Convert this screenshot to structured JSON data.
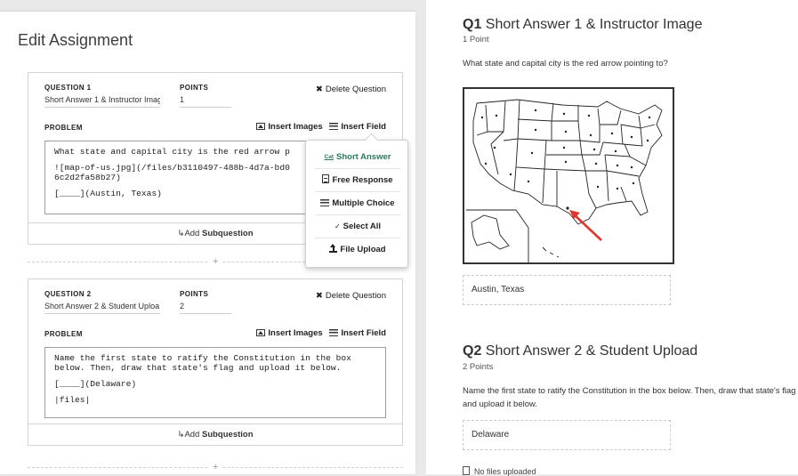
{
  "editor": {
    "title": "Edit Assignment",
    "labels": {
      "question_prefix": "QUESTION",
      "points": "POINTS",
      "problem": "PROBLEM",
      "delete": "Delete Question",
      "insert_images": "Insert Images",
      "insert_field": "Insert Field",
      "add_prefix": "Add",
      "subquestion": "Subquestion",
      "plus": "+"
    },
    "questions": [
      {
        "label": "QUESTION 1",
        "name": "Short Answer 1 & Instructor Imag",
        "points": "1",
        "problem_lines": [
          "What state and capital city is the red arrow p",
          "![map-of-us.jpg](/files/b3110497-488b-4d7a-bd0\n6c2d2fa58b27)",
          "[____](Austin, Texas)"
        ]
      },
      {
        "label": "QUESTION 2",
        "name": "Short Answer 2 & Student Uploa",
        "points": "2",
        "problem_lines": [
          "Name the first state to ratify the Constitution in the box\nbelow. Then, draw that state's flag and upload it below.",
          "[____](Delaware)",
          "|files|"
        ]
      }
    ]
  },
  "insert_field_menu": {
    "items": [
      {
        "label": "Short Answer",
        "icon": "text-icon",
        "icon_text": "Cat",
        "active": true
      },
      {
        "label": "Free Response",
        "icon": "document-icon"
      },
      {
        "label": "Multiple Choice",
        "icon": "list-icon"
      },
      {
        "label": "Select All",
        "icon": "checklist-icon",
        "icon_text": "✓"
      },
      {
        "label": "File Upload",
        "icon": "upload-icon"
      }
    ],
    "accent_color": "#2a7a5a"
  },
  "preview": {
    "q1": {
      "number": "Q1",
      "title": "Short Answer 1 & Instructor Image",
      "points": "1 Point",
      "text": "What state and capital city is the red arrow pointing to?",
      "answer": "Austin, Texas"
    },
    "q2": {
      "number": "Q2",
      "title": "Short Answer 2 & Student Upload",
      "points": "2 Points",
      "text": "Name the first state to ratify the Constitution in the box below. Then, draw that state's flag and upload it below.",
      "answer": "Delaware",
      "files_status": "No files uploaded"
    }
  }
}
